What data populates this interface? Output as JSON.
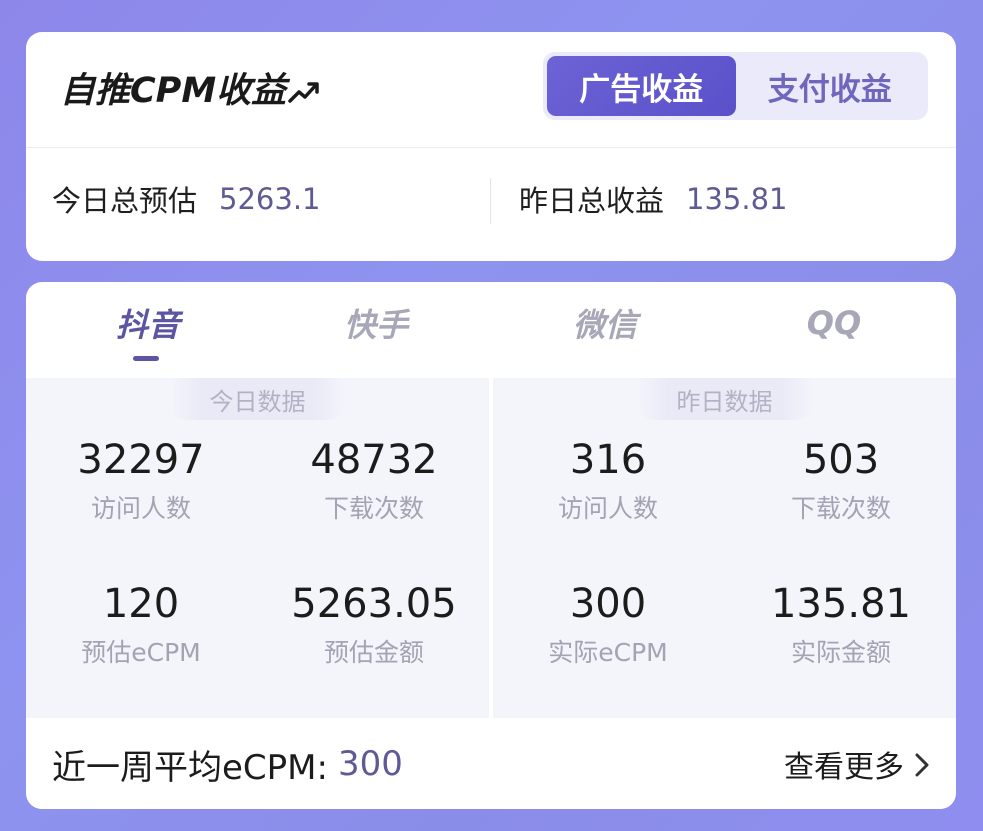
{
  "header": {
    "title": "自推CPM收益",
    "segment": {
      "options": [
        "广告收益",
        "支付收益"
      ],
      "selected": "广告收益"
    }
  },
  "summary": {
    "today_label": "今日总预估",
    "today_value": "5263.1",
    "yesterday_label": "昨日总收益",
    "yesterday_value": "135.81"
  },
  "tabs": [
    {
      "label": "抖音",
      "active": true
    },
    {
      "label": "快手",
      "active": false
    },
    {
      "label": "微信",
      "active": false
    },
    {
      "label": "QQ",
      "active": false
    }
  ],
  "today": {
    "title": "今日数据",
    "metrics": [
      {
        "value": "32297",
        "label": "访问人数"
      },
      {
        "value": "48732",
        "label": "下载次数"
      },
      {
        "value": "120",
        "label": "预估eCPM"
      },
      {
        "value": "5263.05",
        "label": "预估金额"
      }
    ]
  },
  "yesterday": {
    "title": "昨日数据",
    "metrics": [
      {
        "value": "316",
        "label": "访问人数"
      },
      {
        "value": "503",
        "label": "下载次数"
      },
      {
        "value": "300",
        "label": "实际eCPM"
      },
      {
        "value": "135.81",
        "label": "实际金额"
      }
    ]
  },
  "footer": {
    "avg_label": "近一周平均eCPM:",
    "avg_value": "300",
    "more_label": "查看更多"
  },
  "colors": {
    "accent": "#5b55a3",
    "segment_active": "#5f56cf",
    "background": "#8d8eee"
  }
}
